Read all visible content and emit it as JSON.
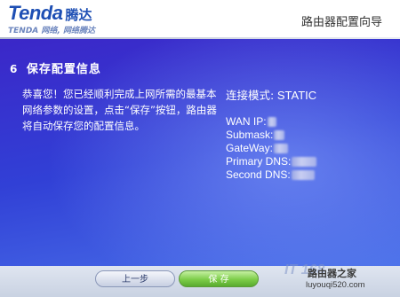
{
  "header": {
    "logo_en": "Tenda",
    "logo_cn": "腾达",
    "slogan": "TENDA 网络, 网络腾达",
    "wizard_title": "路由器配置向导"
  },
  "section": {
    "number": "6",
    "title": "保存配置信息"
  },
  "description": "恭喜您！您已经顺利完成上网所需的最基本网络参数的设置，点击“保存”按钮，路由器将自动保存您的配置信息。",
  "connection": {
    "mode_label": "连接模式:",
    "mode_value": "STATIC",
    "fields": {
      "wan_ip": "WAN IP:",
      "submask": "Submask:",
      "gateway": "GateWay:",
      "primary_dns": "Primary DNS:",
      "second_dns": "Second DNS:"
    }
  },
  "buttons": {
    "prev": "上一步",
    "save": "保 存"
  },
  "watermark": {
    "mark": "IT 168",
    "site_name": "路由器之家",
    "url": "luyouqi520.com"
  },
  "colors": {
    "brand_blue": "#1e4fb4",
    "panel_top": "#3b27c8",
    "panel_bottom": "#4d78ec",
    "save_green": "#7ccd48"
  },
  "icons": {
    "step_marker": "number-6"
  }
}
